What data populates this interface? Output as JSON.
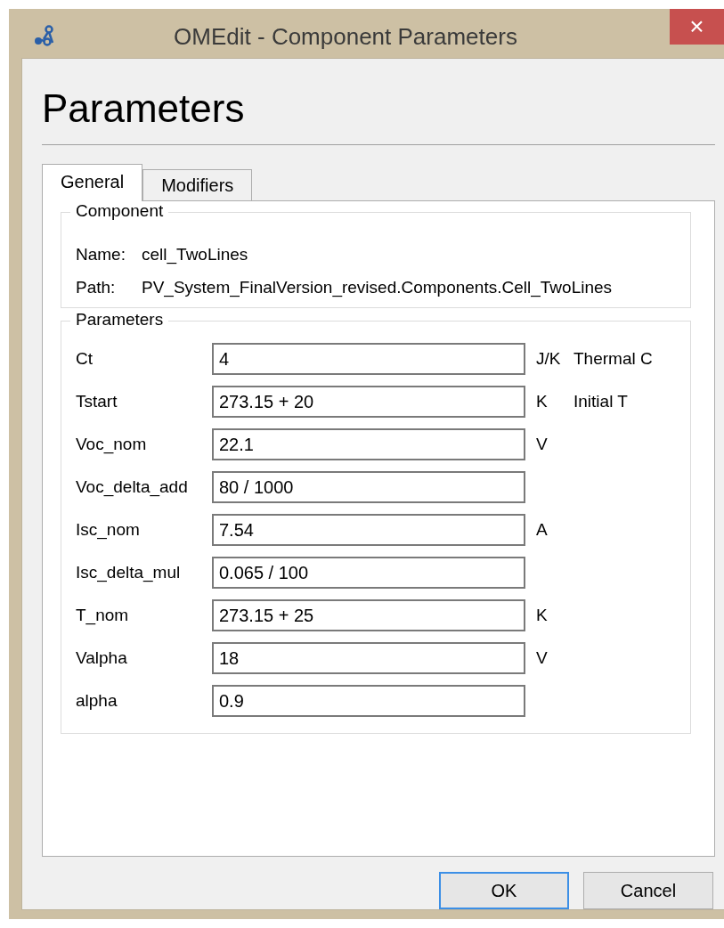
{
  "window": {
    "title": "OMEdit - Component Parameters",
    "close": "×"
  },
  "heading": "Parameters",
  "tabs": [
    {
      "label": "General",
      "selected": true
    },
    {
      "label": "Modifiers",
      "selected": false
    }
  ],
  "component": {
    "title": "Component",
    "fields": [
      {
        "label": "Name:",
        "value": "cell_TwoLines"
      },
      {
        "label": "Path:",
        "value": "PV_System_FinalVersion_revised.Components.Cell_TwoLines"
      }
    ]
  },
  "parameters": {
    "title": "Parameters",
    "rows": [
      {
        "name": "Ct",
        "value": "4",
        "unit": "J/K",
        "description": "Thermal C"
      },
      {
        "name": "Tstart",
        "value": "273.15 + 20",
        "unit": "K",
        "description": "Initial T"
      },
      {
        "name": "Voc_nom",
        "value": "22.1",
        "unit": "V"
      },
      {
        "name": "Voc_delta_add",
        "value": "80 / 1000"
      },
      {
        "name": "Isc_nom",
        "value": "7.54",
        "unit": "A"
      },
      {
        "name": "Isc_delta_mul",
        "value": "0.065 / 100"
      },
      {
        "name": "T_nom",
        "value": "273.15 + 25",
        "unit": "K"
      },
      {
        "name": "Valpha",
        "value": "18",
        "unit": "V"
      },
      {
        "name": "alpha",
        "value": "0.9"
      }
    ]
  },
  "buttons": [
    {
      "label": "OK",
      "default": true
    },
    {
      "label": "Cancel",
      "default": false
    }
  ]
}
